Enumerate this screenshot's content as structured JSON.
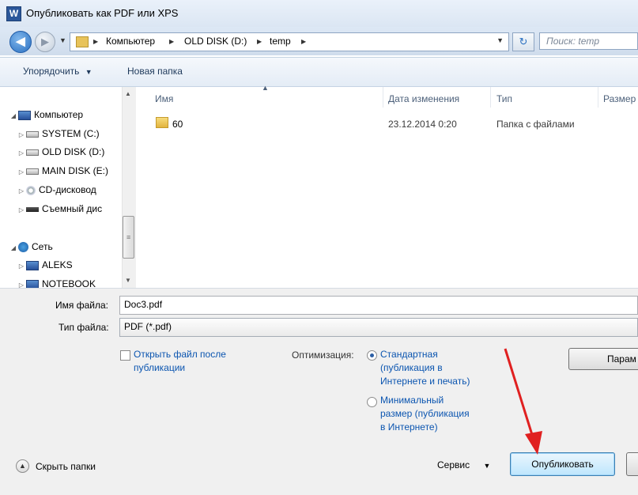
{
  "window": {
    "title": "Опубликовать как PDF или XPS",
    "app_icon_letter": "W"
  },
  "navigation": {
    "back_glyph": "◀",
    "forward_glyph": "▶",
    "breadcrumbs": [
      "Компьютер",
      "OLD DISK (D:)",
      "temp"
    ],
    "search_placeholder": "Поиск: temp"
  },
  "toolbar": {
    "organize_label": "Упорядочить",
    "new_folder_label": "Новая папка"
  },
  "nav_pane": {
    "items": [
      {
        "label": "Компьютер",
        "icon": "computer-icon"
      },
      {
        "label": "SYSTEM (C:)",
        "icon": "drive-icon"
      },
      {
        "label": "OLD DISK (D:)",
        "icon": "drive-icon",
        "selected": true
      },
      {
        "label": "MAIN DISK (E:)",
        "icon": "drive-icon"
      },
      {
        "label": "CD-дисковод",
        "icon": "cd-drive-icon"
      },
      {
        "label": "Съемный дис",
        "icon": "removable-drive-icon"
      },
      {
        "label": "Сеть",
        "icon": "network-icon"
      },
      {
        "label": "ALEKS",
        "icon": "computer-icon"
      },
      {
        "label": "NOTEBOOK",
        "icon": "computer-icon"
      }
    ]
  },
  "file_list": {
    "columns": [
      "Имя",
      "Дата изменения",
      "Тип",
      "Размер"
    ],
    "rows": [
      {
        "name": "60",
        "date": "23.12.2014 0:20",
        "type": "Папка с файлами"
      }
    ]
  },
  "form": {
    "filename_label": "Имя файла:",
    "filename_value": "Doc3.pdf",
    "filetype_label": "Тип файла:",
    "filetype_value": "PDF (*.pdf)",
    "open_after_line1": "Открыть файл после",
    "open_after_line2": "публикации",
    "optimize_label": "Оптимизация:",
    "opt_standard_line1": "Стандартная",
    "opt_standard_line2": "(публикация в",
    "opt_standard_line3": "Интернете и печать)",
    "opt_minimal_line1": "Минимальный",
    "opt_minimal_line2": "размер (публикация",
    "opt_minimal_line3": "в Интернете)",
    "params_button": "Парам",
    "hide_folders": "Скрыть папки",
    "service_label": "Сервис",
    "publish_button": "Опубликовать"
  },
  "colors": {
    "annotation_arrow": "#e02020",
    "selected_bg": "#cfe3f8",
    "link_text": "#0b55b0"
  }
}
